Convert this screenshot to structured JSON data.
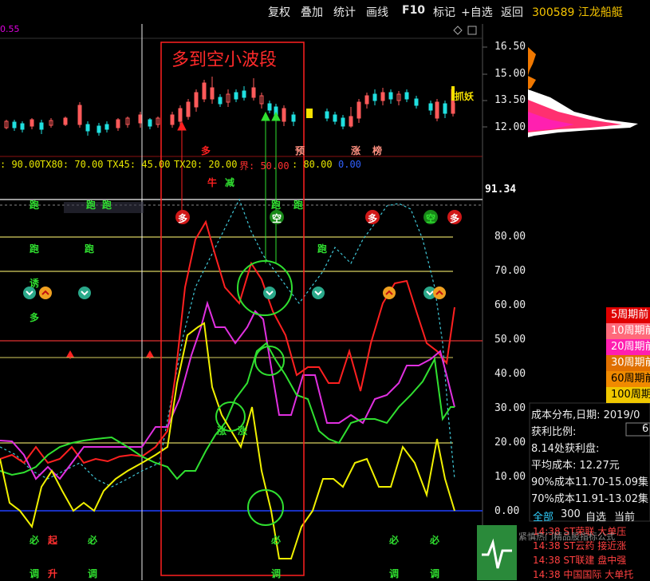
{
  "toolbar": {
    "items": [
      "复权",
      "叠加",
      "统计",
      "画线",
      "F10",
      "标记",
      "+自选",
      "返回"
    ],
    "stock_code": "300589 江龙船艇"
  },
  "left_partial_value": "0.55",
  "price_axis": [
    "16.50",
    "15.00",
    "13.50",
    "12.00"
  ],
  "indicator_axis": [
    "91.34",
    "80.00",
    "70.00",
    "60.00",
    "50.00",
    "40.00",
    "30.00",
    "20.00",
    "10.00",
    "0.00"
  ],
  "indicator_legend": [
    {
      "text": ": 90.00",
      "color": "#e6e600"
    },
    {
      "text": "TX80: 70.00",
      "color": "#e6e600"
    },
    {
      "text": "TX45: 45.00",
      "color": "#e6e600"
    },
    {
      "text": "TX20: 20.00",
      "color": "#e6e600"
    },
    {
      "text": "界: 50.00",
      "color": "#ff3030"
    },
    {
      "text": ": 80.00",
      "color": "#e6e600"
    },
    {
      "text": "0.00",
      "color": "#3060ff"
    }
  ],
  "annotation_title": "多到空小波段",
  "price_tags": {
    "tag1": "抓妖",
    "tag2": "预",
    "tag3": "涨",
    "tag4": "榜",
    "tag5": "多"
  },
  "signals": {
    "niu": "牛",
    "jian": "减",
    "duo": "多",
    "kong": "空",
    "pao": "跑",
    "you": "诱",
    "bi": "必",
    "qi": "起",
    "tiao": "调",
    "sheng": "升",
    "shang": "上",
    "zhang": "涨"
  },
  "period_legend": [
    {
      "label": "5周期前",
      "bg": "#e00000",
      "color": "#ffffff"
    },
    {
      "label": "10周期前",
      "bg": "#ff6a7a",
      "color": "#ffffff"
    },
    {
      "label": "20周期前",
      "bg": "#ff1fb0",
      "color": "#ffffff"
    },
    {
      "label": "30周期前",
      "bg": "#e07000",
      "color": "#ffffff"
    },
    {
      "label": "60周期前",
      "bg": "#f08a00",
      "color": "#000000"
    },
    {
      "label": "100周期前",
      "bg": "#f0c800",
      "color": "#000000"
    }
  ],
  "cost_info": {
    "date_line": "成本分布,日期: 2019/0",
    "profit_label": "获利比例:",
    "profit_value": "6",
    "profit_at": "8.14处获利盘:",
    "avg_cost": "平均成本: 12.27元",
    "cost90": "90%成本11.70-15.09集",
    "cost70": "70%成本11.91-13.02集"
  },
  "bottom_tabs": [
    "全部",
    "300",
    "自选",
    "当前"
  ],
  "ticker": [
    {
      "time": "14:38",
      "text": "ST荣联",
      "tag": "大单压"
    },
    {
      "time": "14:38",
      "text": "ST云药",
      "tag": "接近涨"
    },
    {
      "time": "14:38",
      "text": "ST联建",
      "tag": "盘中强"
    },
    {
      "time": "14:38",
      "text": "中国国际",
      "tag": "大单托"
    }
  ],
  "watermark": "紧慎热门精品股指标公式"
}
